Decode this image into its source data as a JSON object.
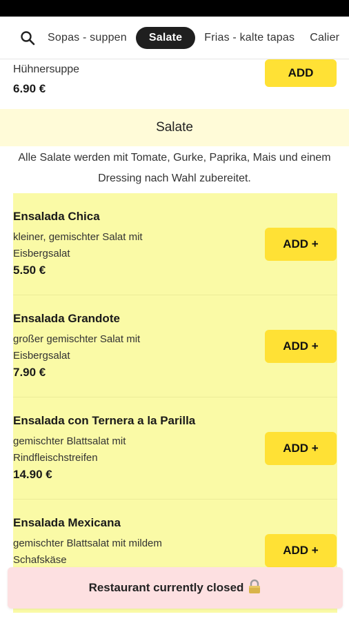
{
  "nav": {
    "tabs": [
      {
        "label": "Sopas - suppen",
        "active": false
      },
      {
        "label": "Salate",
        "active": true
      },
      {
        "label": "Frias - kalte tapas",
        "active": false
      },
      {
        "label": "Calier",
        "active": false
      }
    ]
  },
  "previous_item": {
    "name": "Hühnersuppe",
    "price": "6.90 €",
    "add_label": "ADD"
  },
  "section": {
    "title": "Salate",
    "description": "Alle Salate werden mit Tomate, Gurke, Paprika, Mais und einem Dressing nach Wahl zubereitet."
  },
  "items": [
    {
      "name": "Ensalada Chica",
      "description": "kleiner, gemischter Salat mit Eisbergsalat",
      "price": "5.50 €",
      "add_label": "ADD +"
    },
    {
      "name": "Ensalada Grandote",
      "description": "großer gemischter Salat mit Eisbergsalat",
      "price": "7.90 €",
      "add_label": "ADD +"
    },
    {
      "name": "Ensalada con Ternera a la Parilla",
      "description": "gemischter Blattsalat mit Rindfleischstreifen",
      "price": "14.90 €",
      "add_label": "ADD +"
    },
    {
      "name": "Ensalada Mexicana",
      "description": "gemischter Blattsalat mit mildem Schafskäse",
      "price": "",
      "add_label": "ADD +"
    }
  ],
  "banner": {
    "text": "Restaurant currently closed"
  },
  "colors": {
    "accent_yellow": "#ffe135",
    "item_background": "#fafaa6",
    "section_header_background": "#fffbd8",
    "closed_banner_background": "#fde0e1",
    "active_tab": "#1f1f1f"
  },
  "icons": {
    "search": "search-icon",
    "lock": "lock-icon"
  }
}
